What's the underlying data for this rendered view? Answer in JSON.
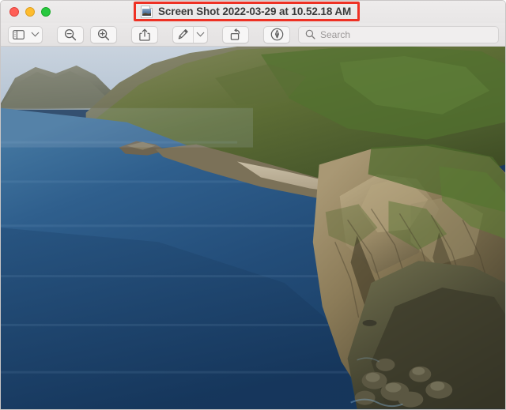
{
  "window": {
    "app": "Preview",
    "title": "Screen Shot 2022-03-29 at 10.52.18 AM",
    "doc_icon": "image-document-icon",
    "traffic_lights": [
      {
        "name": "close-button",
        "label": "Close",
        "color": "#ff5f57"
      },
      {
        "name": "minimize-button",
        "label": "Minimize",
        "color": "#febc2e"
      },
      {
        "name": "maximize-button",
        "label": "Maximize",
        "color": "#28c840"
      }
    ]
  },
  "annotation": {
    "shape": "rectangle",
    "color": "#ee3124",
    "target": "window-title",
    "stroke_width": 3
  },
  "toolbar": {
    "buttons": [
      {
        "name": "sidebar-toggle-button",
        "icon": "sidebar-icon",
        "label": "Sidebar",
        "has_menu": true
      },
      {
        "name": "zoom-out-button",
        "icon": "zoom-out-icon",
        "label": "Zoom Out",
        "has_menu": false
      },
      {
        "name": "zoom-in-button",
        "icon": "zoom-in-icon",
        "label": "Zoom In",
        "has_menu": false
      },
      {
        "name": "share-button",
        "icon": "share-icon",
        "label": "Share",
        "has_menu": false
      },
      {
        "name": "markup-button",
        "icon": "pen-icon",
        "label": "Markup",
        "has_menu": true
      },
      {
        "name": "rotate-button",
        "icon": "rotate-left-icon",
        "label": "Rotate Left",
        "has_menu": false
      },
      {
        "name": "annotate-button",
        "icon": "pen-nib-circle-icon",
        "label": "Annotate",
        "has_menu": false
      }
    ]
  },
  "search": {
    "placeholder": "Search",
    "value": "",
    "icon": "search-icon"
  },
  "image": {
    "name": "coastal-cliff-photograph",
    "description": "Aerial coastal landscape: deep blue ocean bay at left, rugged rocky headlands with green and tan vegetation sweeping from the upper left to the lower right, pale blue sky along the top-left horizon.",
    "palette": {
      "sky": "#c5cfdc",
      "ocean_deep": "#1e4570",
      "ocean_mid": "#2a5684",
      "ocean_light": "#4a7ba8",
      "rock_tan": "#9a8a6d",
      "rock_dark": "#4a4334",
      "vegetation_green": "#5f7a3c",
      "vegetation_dark": "#33471f",
      "shadow": "#2c2a20"
    }
  }
}
